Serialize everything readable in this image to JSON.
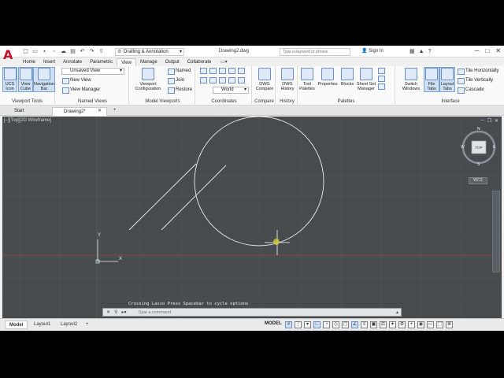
{
  "title_bar": {
    "logo": "A",
    "workspace": "Drafting & Annotation",
    "document_title": "Drawing2.dwg",
    "search_placeholder": "Type a keyword or phrase",
    "signin": "Sign In"
  },
  "tabs": [
    "Home",
    "Insert",
    "Annotate",
    "Parametric",
    "View",
    "Manage",
    "Output",
    "Collaborate"
  ],
  "active_tab": "View",
  "ribbon": {
    "viewport_tools": {
      "title": "Viewport Tools",
      "ucs_icon": "UCS\nIcon",
      "view_cube": "View\nCube",
      "navigation_bar": "Navigation\nBar"
    },
    "named_views": {
      "title": "Named Views",
      "dropdown": "Unsaved View",
      "new_view": "New View",
      "view_manager": "View Manager"
    },
    "model_viewports": {
      "title": "Model Viewports",
      "config_label": "Viewport\nConfiguration",
      "named": "Named",
      "join": "Join",
      "restore": "Restore"
    },
    "coordinates": {
      "title": "Coordinates",
      "dropdown": "World"
    },
    "compare": {
      "title": "Compare",
      "btn": "DWG\nCompare"
    },
    "history": {
      "title": "History",
      "btn": "DWG\nHistory"
    },
    "palettes": {
      "title": "Palettes",
      "tool_palettes": "Tool\nPalettes",
      "properties": "Properties",
      "blocks": "Blocks",
      "sheet_set": "Sheet Set\nManager"
    },
    "interface": {
      "title": "Interface",
      "switch_windows": "Switch\nWindows",
      "file_tabs": "File\nTabs",
      "layout_tabs": "Layout\nTabs",
      "tile_h": "Tile Horizontally",
      "tile_v": "Tile Vertically",
      "cascade": "Cascade"
    }
  },
  "file_tabs": {
    "start": "Start",
    "drawing": "Drawing2*",
    "add": "+"
  },
  "viewport_label": "[–][Top][2D Wireframe]",
  "viewcube": {
    "top": "TOP",
    "n": "N",
    "s": "S",
    "e": "E",
    "w": "W",
    "wcs": "WCS"
  },
  "ucs": {
    "x": "X",
    "y": "Y"
  },
  "command_hint": "Crossing Lasso  Press Spacebar to cycle options",
  "command_placeholder": "Type a command",
  "status": {
    "model_tab": "Model",
    "layout1": "Layout1",
    "layout2": "Layout2",
    "add": "+",
    "model_btn": "MODEL"
  }
}
